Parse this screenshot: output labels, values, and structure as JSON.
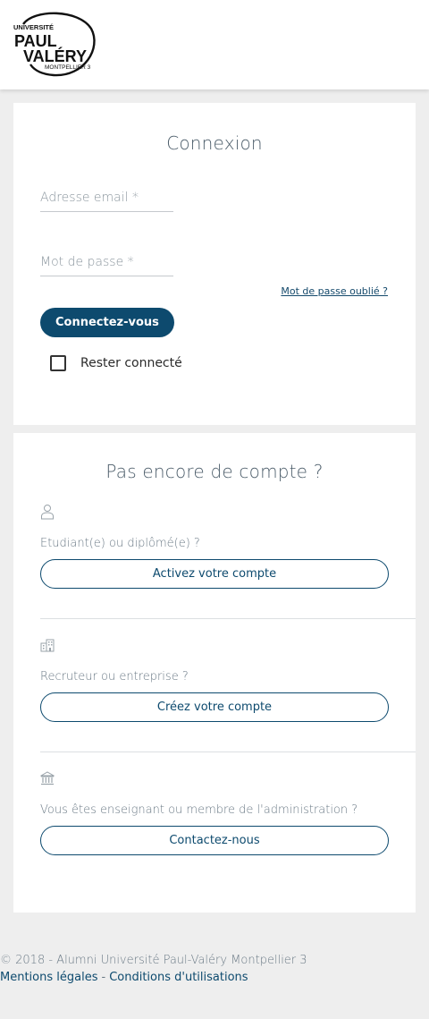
{
  "header": {
    "logo": {
      "line1": "UNIVERSITÉ",
      "line2": "PAUL",
      "line3": "VALÉRY",
      "line4": "MONTPELLIER 3"
    }
  },
  "login": {
    "title": "Connexion",
    "email_placeholder": "Adresse email *",
    "email_value": "",
    "password_placeholder": "Mot de passe *",
    "password_value": "",
    "forgot_label": "Mot de passe oublié ?",
    "submit_label": "Connectez-vous",
    "remember_label": "Rester connecté",
    "remember_checked": false
  },
  "signup": {
    "title": "Pas encore de compte ?",
    "sections": [
      {
        "icon": "user-icon",
        "label": "Etudiant(e) ou diplômé(e) ?",
        "button": "Activez votre compte"
      },
      {
        "icon": "building-icon",
        "label": "Recruteur ou entreprise ?",
        "button": "Créez votre compte"
      },
      {
        "icon": "institution-icon",
        "label": "Vous êtes enseignant ou membre de l'administration ?",
        "button": "Contactez-nous"
      }
    ]
  },
  "footer": {
    "copyright": "© 2018 - Alumni Université Paul-Valéry Montpellier 3",
    "legal_link": "Mentions légales",
    "separator": "-",
    "terms_link": "Conditions d'utilisations"
  },
  "colors": {
    "primary": "#0d4a6e",
    "page_bg": "#eeeeee",
    "card_bg": "#ffffff",
    "muted_text": "#6b7a86"
  }
}
